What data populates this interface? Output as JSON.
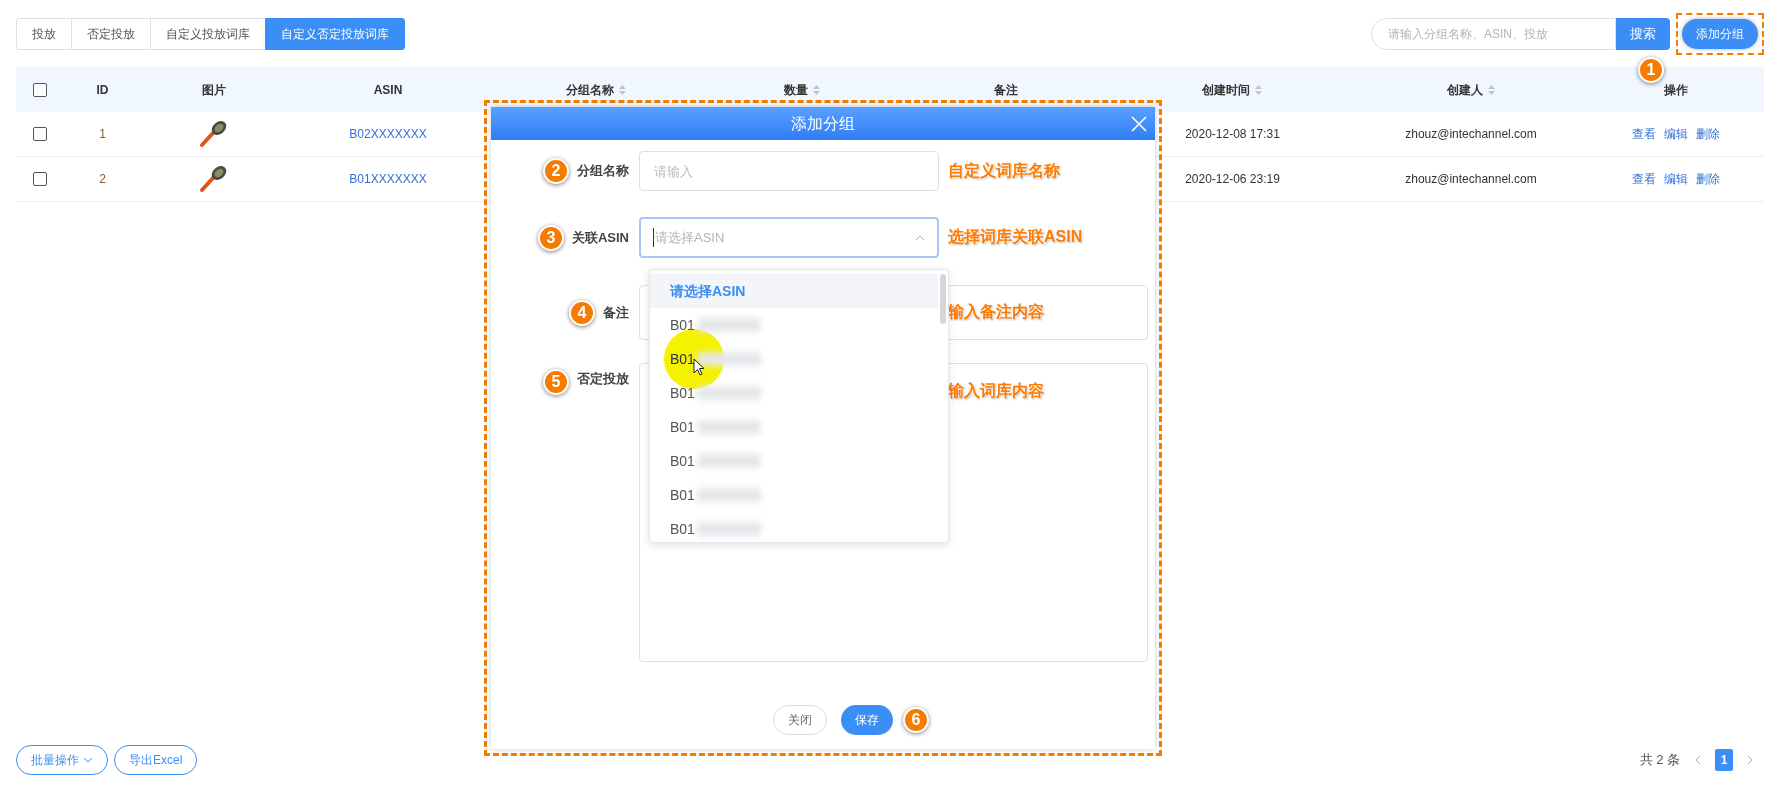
{
  "tabs": [
    {
      "label": "投放",
      "selected": false
    },
    {
      "label": "否定投放",
      "selected": false
    },
    {
      "label": "自定义投放词库",
      "selected": false
    },
    {
      "label": "自定义否定投放词库",
      "selected": true
    }
  ],
  "search": {
    "placeholder": "请输入分组名称、ASIN、投放",
    "button": "搜索"
  },
  "add_button": {
    "label": "添加分组",
    "step": "1"
  },
  "table": {
    "select_all_checked": false,
    "columns": [
      {
        "label": "ID",
        "sortable": false
      },
      {
        "label": "图片",
        "sortable": false
      },
      {
        "label": "ASIN",
        "sortable": false
      },
      {
        "label": "分组名称",
        "sortable": true
      },
      {
        "label": "数量",
        "sortable": true
      },
      {
        "label": "备注",
        "sortable": false
      },
      {
        "label": "创建时间",
        "sortable": true
      },
      {
        "label": "创建人",
        "sortable": true
      },
      {
        "label": "操作",
        "sortable": false
      }
    ],
    "rows": [
      {
        "checked": false,
        "id": "1",
        "asin": "B02XXXXXXX",
        "created": "2020-12-08 17:31",
        "creator": "zhouz@intechannel.com",
        "actions": [
          "查看",
          "编辑",
          "删除"
        ]
      },
      {
        "checked": false,
        "id": "2",
        "asin": "B01XXXXXXX",
        "created": "2020-12-06 23:19",
        "creator": "zhouz@intechannel.com",
        "actions": [
          "查看",
          "编辑",
          "删除"
        ]
      }
    ]
  },
  "modal": {
    "title": "添加分组",
    "fields": [
      {
        "kind": "input",
        "step": "2",
        "label": "分组名称",
        "placeholder": "请输入",
        "note": "自定义词库名称"
      },
      {
        "kind": "select",
        "step": "3",
        "label": "关联ASIN",
        "placeholder": "请选择ASIN",
        "note": "选择词库关联ASIN"
      },
      {
        "kind": "input",
        "step": "4",
        "label": "备注",
        "note": "输入备注内容"
      },
      {
        "kind": "textarea",
        "step": "5",
        "label": "否定投放",
        "note": "输入词库内容"
      }
    ],
    "dropdown": {
      "options": [
        {
          "label": "请选择ASIN",
          "selected": true,
          "hovered": false,
          "blurred": false
        },
        {
          "label": "B01",
          "selected": false,
          "hovered": false,
          "blurred": true
        },
        {
          "label": "B01",
          "selected": false,
          "hovered": true,
          "blurred": true
        },
        {
          "label": "B01",
          "selected": false,
          "hovered": false,
          "blurred": true
        },
        {
          "label": "B01",
          "selected": false,
          "hovered": false,
          "blurred": true
        },
        {
          "label": "B01",
          "selected": false,
          "hovered": false,
          "blurred": true
        },
        {
          "label": "B01",
          "selected": false,
          "hovered": false,
          "blurred": true
        },
        {
          "label": "B01",
          "selected": false,
          "hovered": false,
          "blurred": true
        }
      ]
    },
    "buttons": [
      {
        "label": "关闭",
        "kind": "default"
      },
      {
        "label": "保存",
        "kind": "primary",
        "step": "6"
      }
    ]
  },
  "footer": {
    "buttons": [
      {
        "label": "批量操作",
        "kind": "menu"
      },
      {
        "label": "导出Excel",
        "kind": "plain"
      }
    ],
    "total": "共 2 条",
    "pages": [
      {
        "label": "1",
        "selected": true
      }
    ]
  }
}
